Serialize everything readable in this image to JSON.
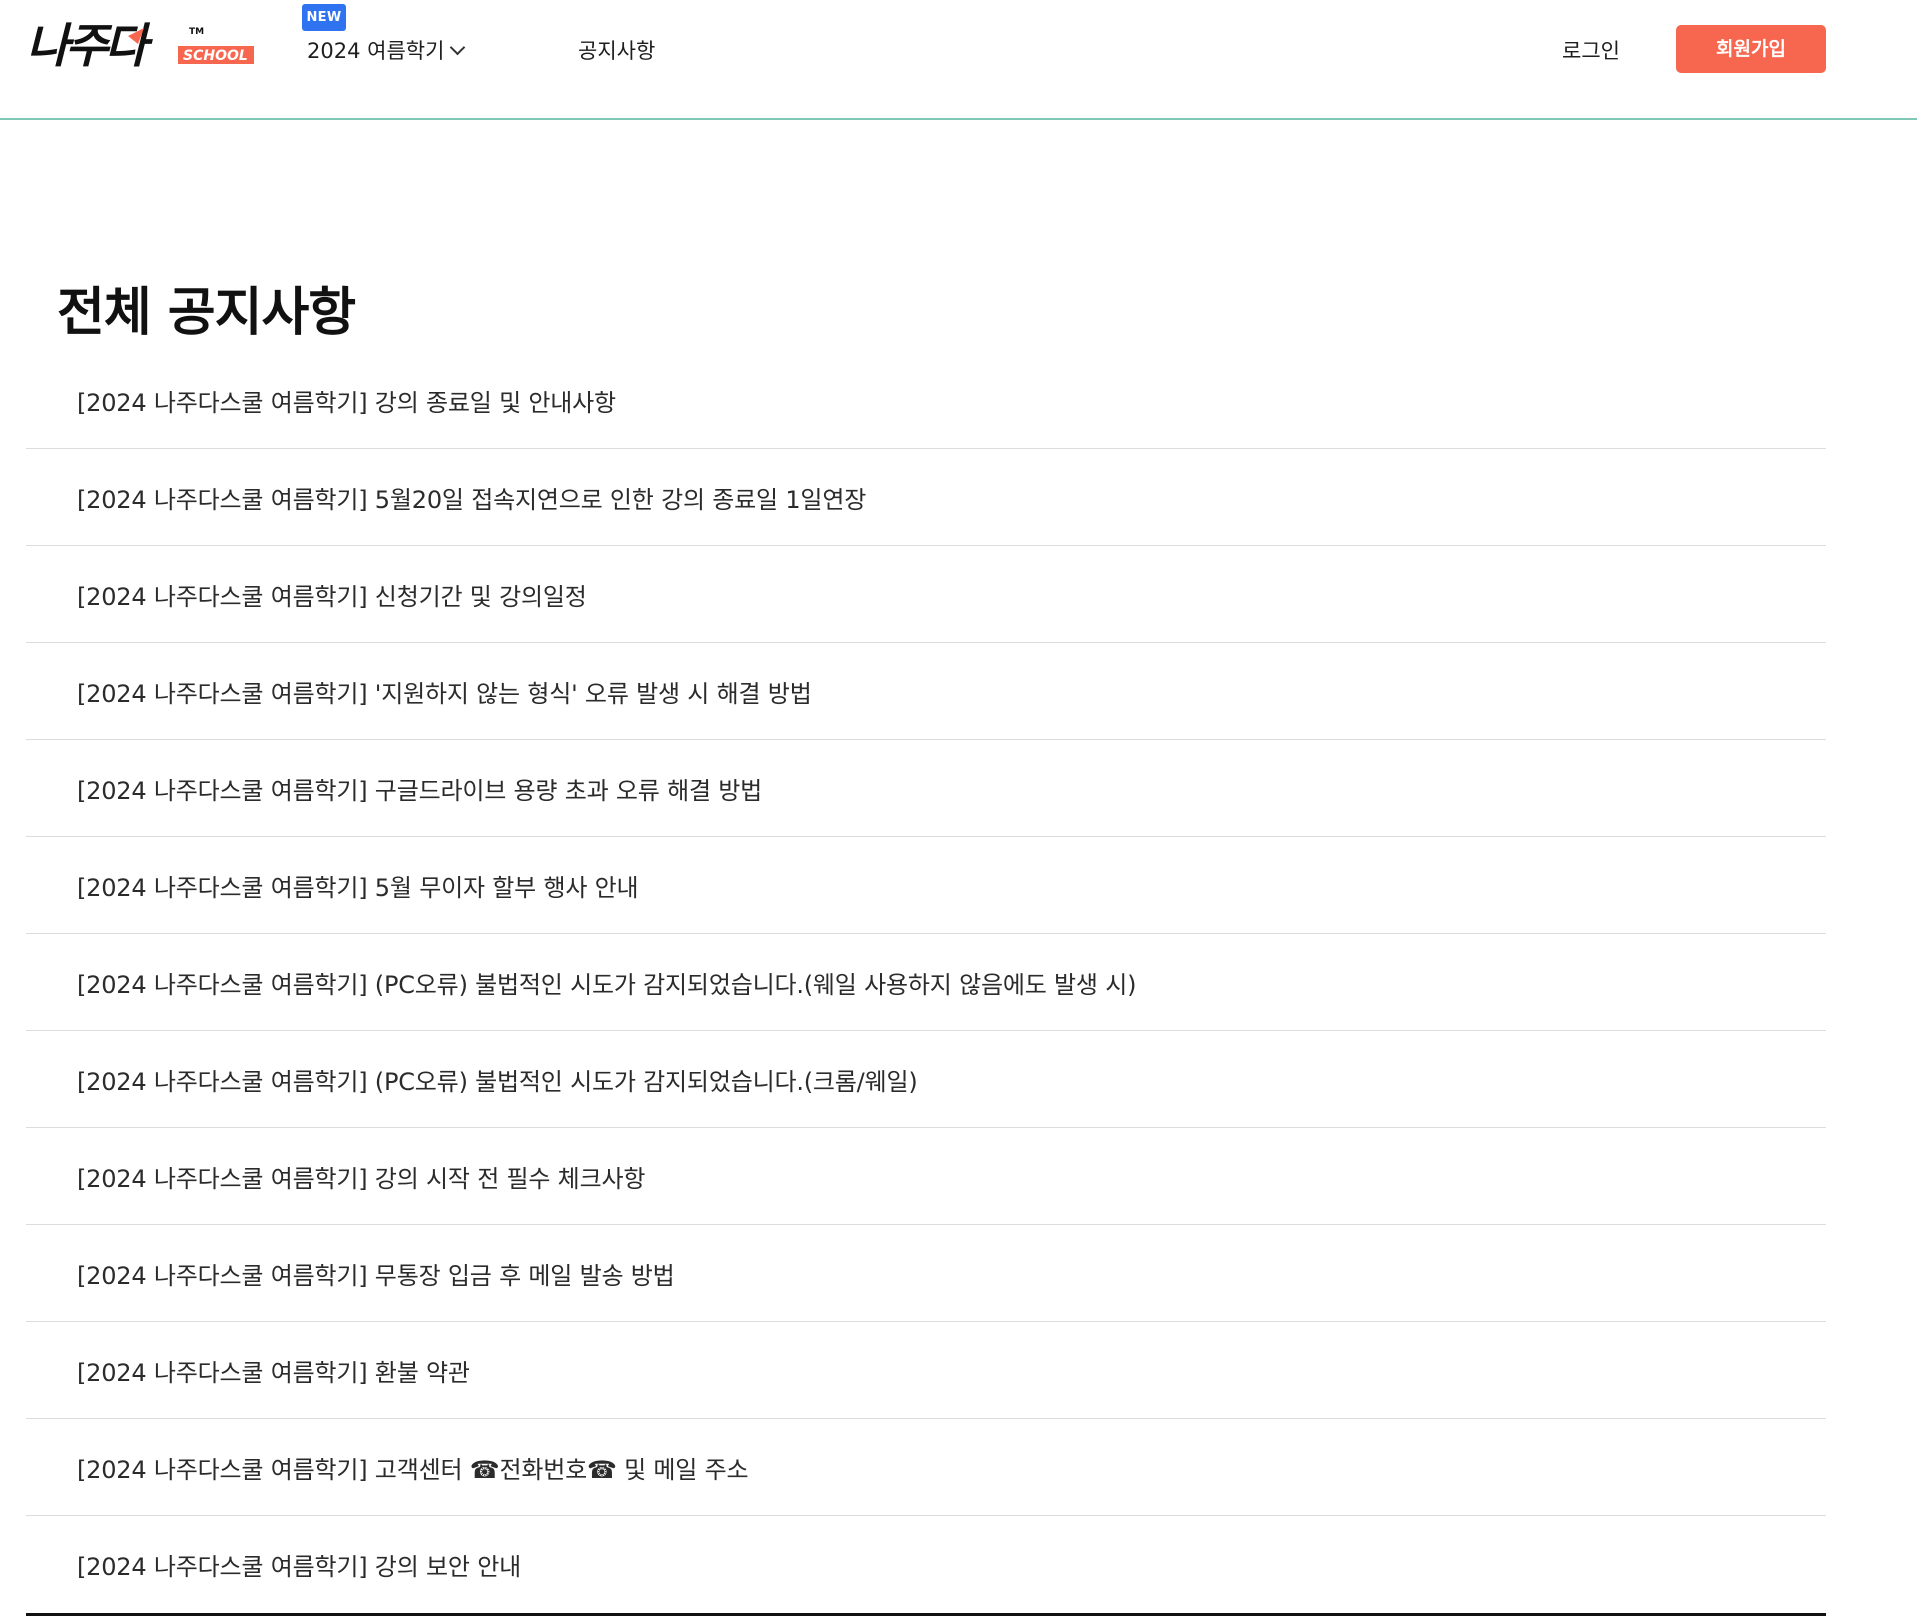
{
  "header": {
    "logo": {
      "main_text": "나주다",
      "sub_text": "SCHOOL",
      "trademark": "TM"
    },
    "nav": {
      "new_badge": "NEW",
      "semester_label": "2024 여름학기",
      "notice_label": "공지사항"
    },
    "login_label": "로그인",
    "signup_label": "회원가입"
  },
  "colors": {
    "accent": "#f7664e",
    "badge_blue": "#2f73f0",
    "header_divider": "#7fc8b8"
  },
  "icons": {
    "semester_dropdown": "chevron-down-icon"
  },
  "main": {
    "title": "전체 공지사항",
    "notices": [
      {
        "title": "[2024 나주다스쿨 여름학기] 강의 종료일 및 안내사항"
      },
      {
        "title": "[2024 나주다스쿨 여름학기] 5월20일 접속지연으로 인한 강의 종료일 1일연장"
      },
      {
        "title": "[2024 나주다스쿨 여름학기] 신청기간 및 강의일정"
      },
      {
        "title": "[2024 나주다스쿨 여름학기] '지원하지 않는 형식' 오류 발생 시 해결 방법"
      },
      {
        "title": "[2024 나주다스쿨 여름학기] 구글드라이브 용량 초과 오류 해결 방법"
      },
      {
        "title": "[2024 나주다스쿨 여름학기] 5월 무이자 할부 행사 안내"
      },
      {
        "title": "[2024 나주다스쿨 여름학기] (PC오류) 불법적인 시도가 감지되었습니다.(웨일 사용하지 않음에도 발생 시)"
      },
      {
        "title": "[2024 나주다스쿨 여름학기] (PC오류) 불법적인 시도가 감지되었습니다.(크롬/웨일)"
      },
      {
        "title": "[2024 나주다스쿨 여름학기] 강의 시작 전 필수 체크사항"
      },
      {
        "title": "[2024 나주다스쿨 여름학기] 무통장 입금 후 메일 발송 방법"
      },
      {
        "title": "[2024 나주다스쿨 여름학기] 환불 약관"
      },
      {
        "title": "[2024 나주다스쿨 여름학기] 고객센터 ☎전화번호☎ 및 메일 주소"
      },
      {
        "title": "[2024 나주다스쿨 여름학기] 강의 보안 안내"
      }
    ]
  }
}
